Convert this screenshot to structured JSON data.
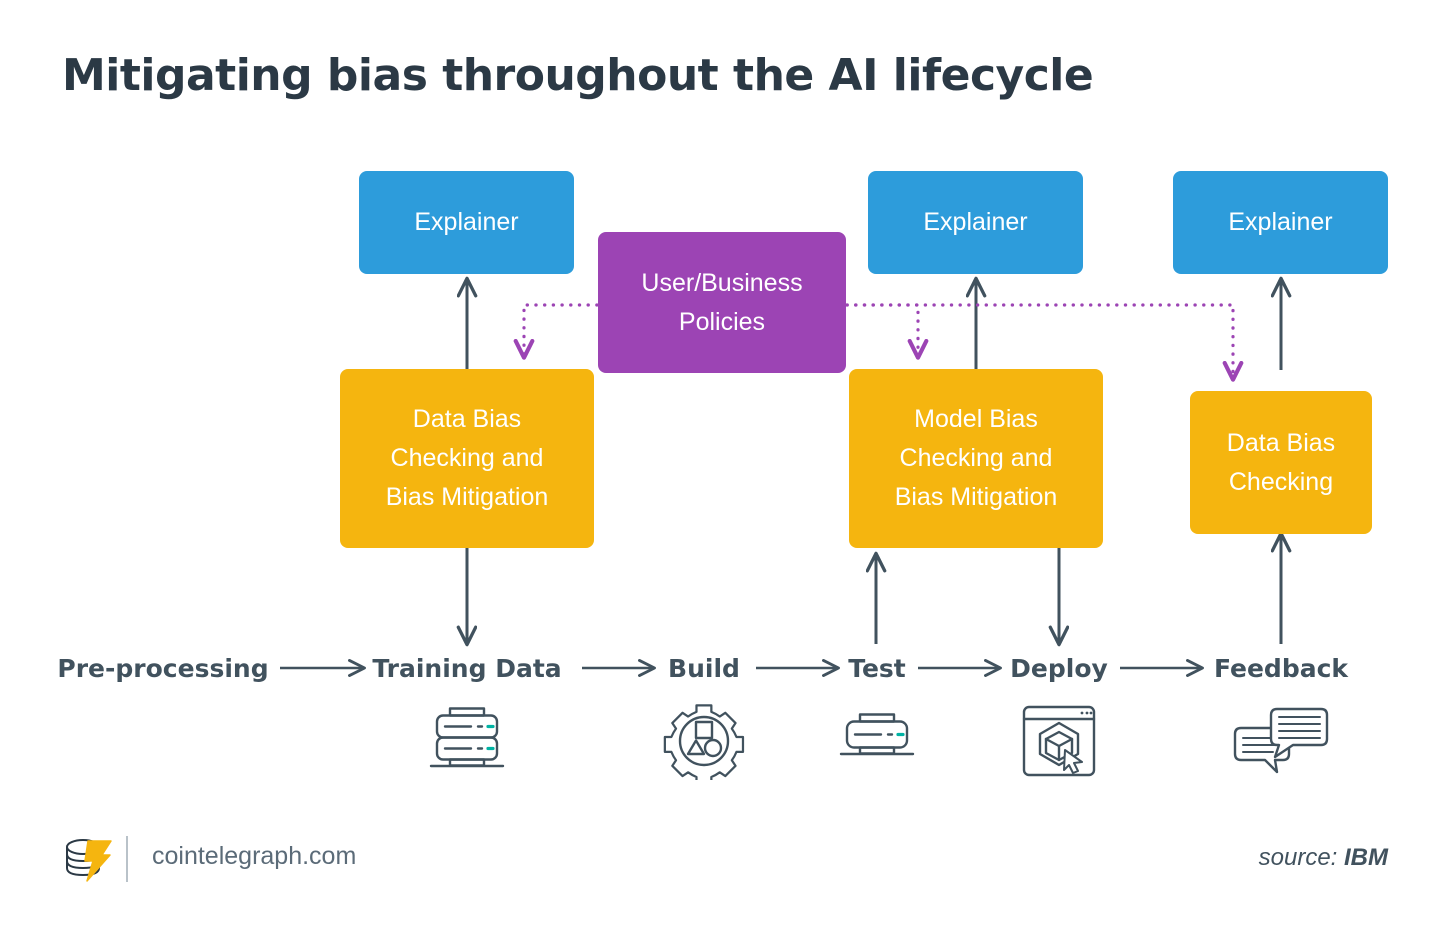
{
  "page": {
    "title": "Mitigating bias throughout the AI lifecycle",
    "background": "#ffffff"
  },
  "colors": {
    "explainer": "#2d9cdb",
    "policy": "#9c44b4",
    "bias": "#f5b50f",
    "arrow": "#41525e",
    "dotted_arrow": "#9c44b4",
    "text_dark": "#2b3945",
    "icon_accent": "#00b3a4"
  },
  "nodes": {
    "explainers": [
      {
        "id": "explainer-1",
        "label": "Explainer"
      },
      {
        "id": "explainer-2",
        "label": "Explainer"
      },
      {
        "id": "explainer-3",
        "label": "Explainer"
      }
    ],
    "policy": {
      "id": "user-business-policies",
      "label": "User/Business\nPolicies"
    },
    "bias_boxes": [
      {
        "id": "data-bias-checking-and-bias-mitigation",
        "label": "Data Bias\nChecking and\nBias Mitigation"
      },
      {
        "id": "model-bias-checking-and-bias-mitigation",
        "label": "Model Bias\nChecking and\nBias Mitigation"
      },
      {
        "id": "data-bias-checking",
        "label": "Data Bias\nChecking"
      }
    ]
  },
  "pipeline": {
    "stages": [
      {
        "id": "pre-processing",
        "label": "Pre-processing",
        "icon": null
      },
      {
        "id": "training-data",
        "label": "Training Data",
        "icon": "server-stack-icon"
      },
      {
        "id": "build",
        "label": "Build",
        "icon": "gear-shapes-icon"
      },
      {
        "id": "test",
        "label": "Test",
        "icon": "server-single-icon"
      },
      {
        "id": "deploy",
        "label": "Deploy",
        "icon": "browser-cube-cursor-icon"
      },
      {
        "id": "feedback",
        "label": "Feedback",
        "icon": "speech-bubbles-icon"
      }
    ]
  },
  "footer": {
    "logo": "cointelegraph-logo",
    "site": "cointelegraph.com",
    "source_prefix": "source: ",
    "source_name": "IBM"
  }
}
